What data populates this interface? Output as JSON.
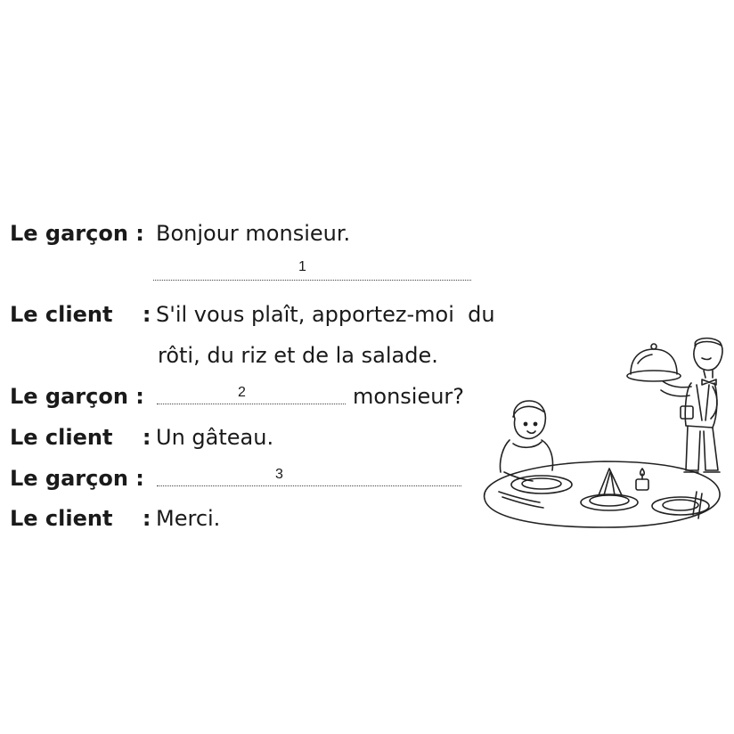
{
  "dialogue": [
    {
      "speaker": "Le garçon :",
      "text": "Bonjour monsieur."
    },
    {
      "blank_number": "1"
    },
    {
      "speaker": "Le client    :",
      "text": "S'il vous plaît, apportez-moi  du"
    },
    {
      "text": "rôti, du riz et de la salade."
    },
    {
      "speaker": "Le garçon :",
      "blank_number": "2",
      "text_after": "monsieur?"
    },
    {
      "speaker": "Le client    :",
      "text": "Un gâteau."
    },
    {
      "speaker": "Le garçon :",
      "blank_number": "3"
    },
    {
      "speaker": "Le client    :",
      "text": "Merci."
    }
  ],
  "illustration": {
    "icon": "restaurant-waiter-child-scene-icon"
  }
}
